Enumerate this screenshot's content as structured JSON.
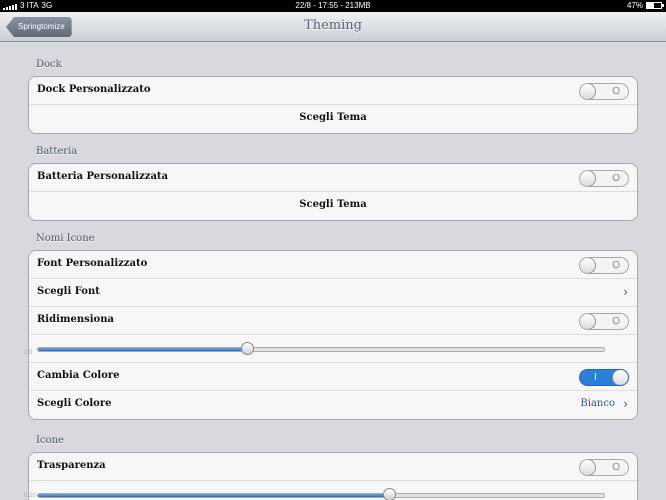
{
  "status_bar": {
    "carrier": "3 ITA",
    "network": "3G",
    "center": "22/8 - 17:55 - 213MB",
    "battery_percent": "47%",
    "battery_level": 0.47
  },
  "nav": {
    "back_label": "Springtomize",
    "title": "Theming"
  },
  "sections": {
    "dock": {
      "header": "Dock",
      "custom_label": "Dock Personalizzato",
      "custom_on": false,
      "choose_label": "Scegli Tema"
    },
    "battery": {
      "header": "Batteria",
      "custom_label": "Batteria Personalizzata",
      "custom_on": false,
      "choose_label": "Scegli Tema"
    },
    "icon_names": {
      "header": "Nomi Icone",
      "font_label": "Font Personalizzato",
      "font_on": false,
      "choose_font_label": "Scegli Font",
      "resize_label": "Ridimensiona",
      "resize_on": false,
      "slider_min": "1.0",
      "slider_value": 0.37,
      "change_color_label": "Cambia Colore",
      "change_color_on": true,
      "choose_color_label": "Scegli Colore",
      "choose_color_value": "Bianco"
    },
    "icons": {
      "header": "Icone",
      "transparency_label": "Trasparenza",
      "transparency_on": false,
      "slider_min": "0.20",
      "slider_value": 0.62
    }
  },
  "toggle": {
    "on_glyph": "I",
    "off_glyph": "O"
  },
  "icons": {
    "chevron": "chevron-right-icon",
    "signal": "signal-bars-icon",
    "battery": "battery-icon"
  },
  "colors": {
    "accent": "#2a7fd8",
    "value_text": "#385487"
  }
}
